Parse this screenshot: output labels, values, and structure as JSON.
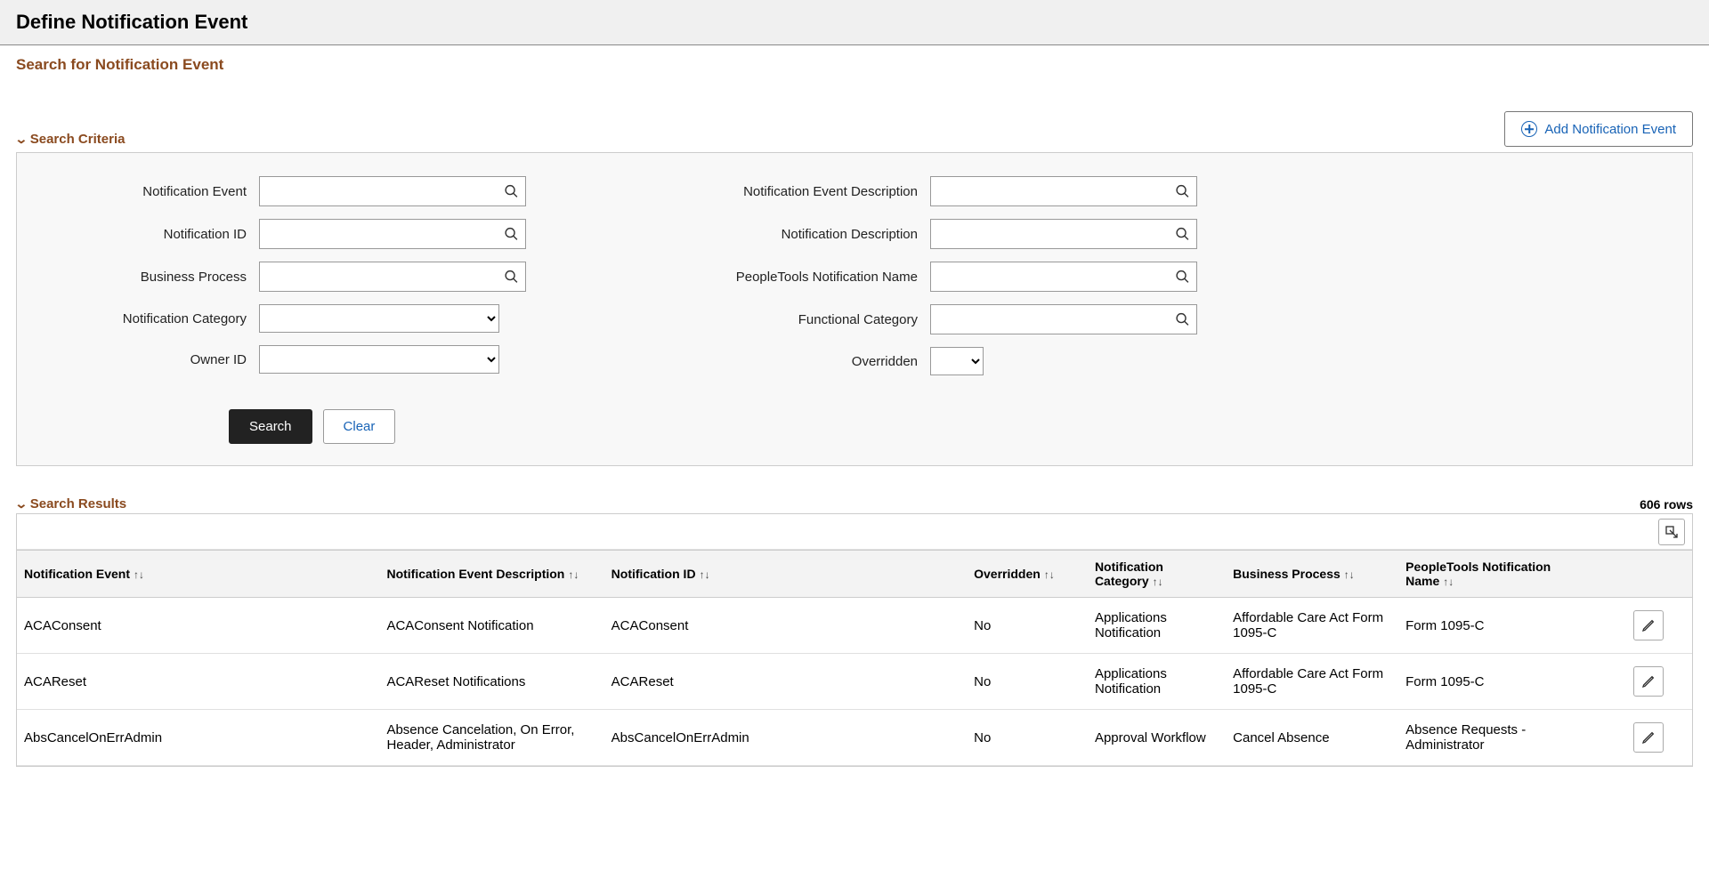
{
  "page": {
    "title": "Define Notification Event",
    "subtitle": "Search for Notification Event",
    "add_button": "Add Notification Event",
    "search_criteria_heading": "Search Criteria",
    "search_results_heading": "Search Results",
    "rows_text": "606 rows"
  },
  "criteria": {
    "left": [
      {
        "label": "Notification Event",
        "type": "prompt"
      },
      {
        "label": "Notification ID",
        "type": "prompt"
      },
      {
        "label": "Business Process",
        "type": "prompt"
      },
      {
        "label": "Notification Category",
        "type": "select"
      },
      {
        "label": "Owner ID",
        "type": "select"
      }
    ],
    "right": [
      {
        "label": "Notification Event Description",
        "type": "prompt"
      },
      {
        "label": "Notification Description",
        "type": "prompt"
      },
      {
        "label": "PeopleTools Notification Name",
        "type": "prompt"
      },
      {
        "label": "Functional Category",
        "type": "prompt"
      },
      {
        "label": "Overridden",
        "type": "select-sm"
      }
    ]
  },
  "buttons": {
    "search": "Search",
    "clear": "Clear"
  },
  "columns": [
    "Notification Event",
    "Notification Event Description",
    "Notification ID",
    "Overridden",
    "Notification Category",
    "Business Process",
    "PeopleTools Notification Name"
  ],
  "rows": [
    {
      "event": "ACAConsent",
      "desc": "ACAConsent Notification",
      "id": "ACAConsent",
      "over": "No",
      "cat": "Applications Notification",
      "bp": "Affordable Care Act Form 1095-C",
      "pt": "Form 1095-C"
    },
    {
      "event": "ACAReset",
      "desc": "ACAReset Notifications",
      "id": "ACAReset",
      "over": "No",
      "cat": "Applications Notification",
      "bp": "Affordable Care Act Form 1095-C",
      "pt": "Form 1095-C"
    },
    {
      "event": "AbsCancelOnErrAdmin",
      "desc": "Absence Cancelation, On Error, Header, Administrator",
      "id": "AbsCancelOnErrAdmin",
      "over": "No",
      "cat": "Approval Workflow",
      "bp": "Cancel Absence",
      "pt": "Absence Requests - Administrator"
    }
  ]
}
